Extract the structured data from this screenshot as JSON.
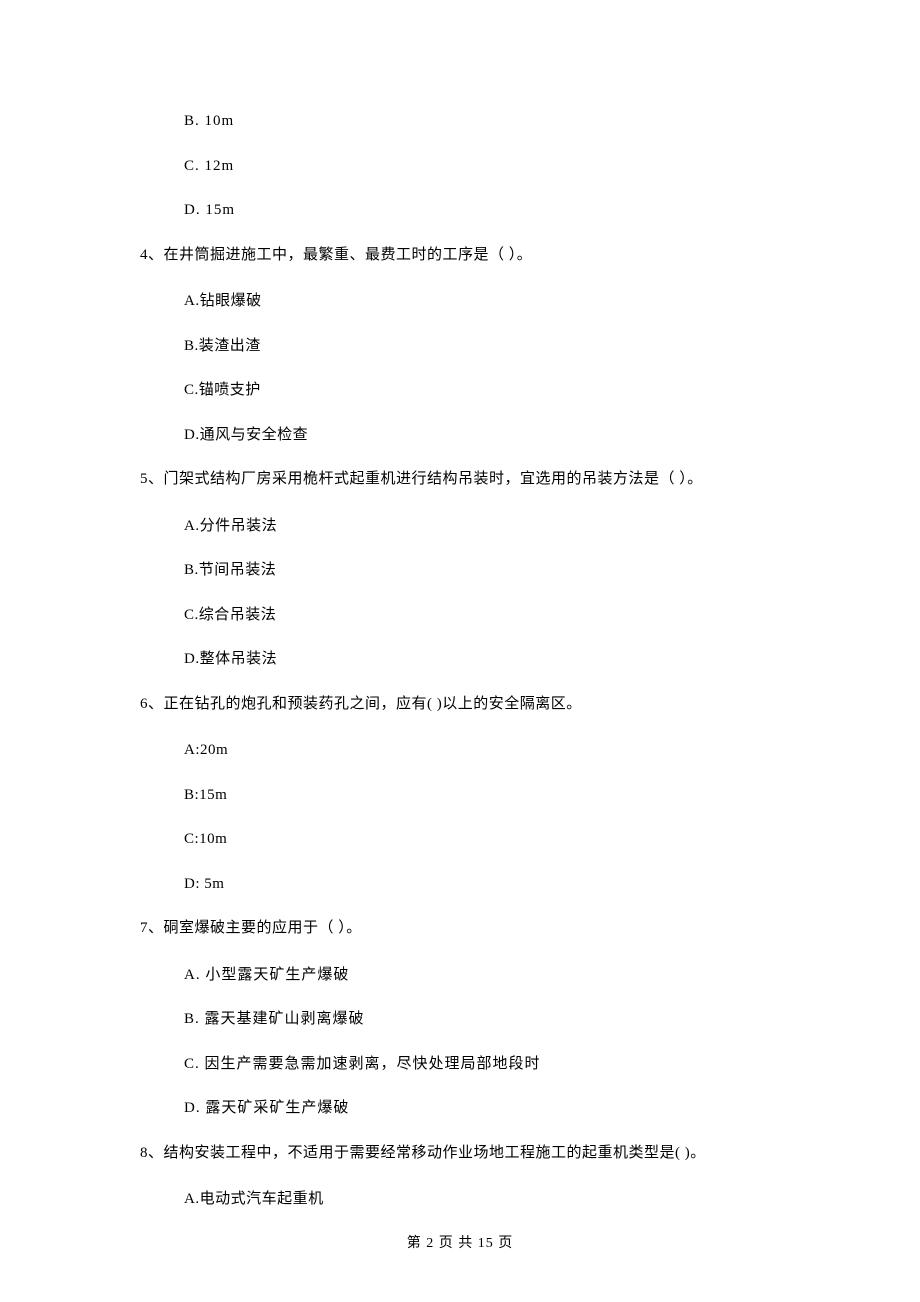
{
  "partial_options_top": {
    "b": "B.  10m",
    "c": "C.  12m",
    "d": "D.  15m"
  },
  "q4": {
    "text": "4、在井筒掘进施工中，最繁重、最费工时的工序是（    ）。",
    "a": "A.钻眼爆破",
    "b": "B.装渣出渣",
    "c": "C.锚喷支护",
    "d": "D.通风与安全检查"
  },
  "q5": {
    "text": "5、门架式结构厂房采用桅杆式起重机进行结构吊装时，宜选用的吊装方法是（    ）。",
    "a": "A.分件吊装法",
    "b": "B.节间吊装法",
    "c": "C.综合吊装法",
    "d": "D.整体吊装法"
  },
  "q6": {
    "text": "6、正在钻孔的炮孔和预装药孔之间，应有(    )以上的安全隔离区。",
    "a": "A:20m",
    "b": "B:15m",
    "c": "C:10m",
    "d": "D:  5m"
  },
  "q7": {
    "text": "7、硐室爆破主要的应用于（    ）。",
    "a": "A.  小型露天矿生产爆破",
    "b": "B.  露天基建矿山剥离爆破",
    "c": "C.  因生产需要急需加速剥离，尽快处理局部地段时",
    "d": "D.  露天矿采矿生产爆破"
  },
  "q8": {
    "text": "8、结构安装工程中，不适用于需要经常移动作业场地工程施工的起重机类型是(     )。",
    "a": "A.电动式汽车起重机"
  },
  "footer": "第 2 页 共 15 页"
}
